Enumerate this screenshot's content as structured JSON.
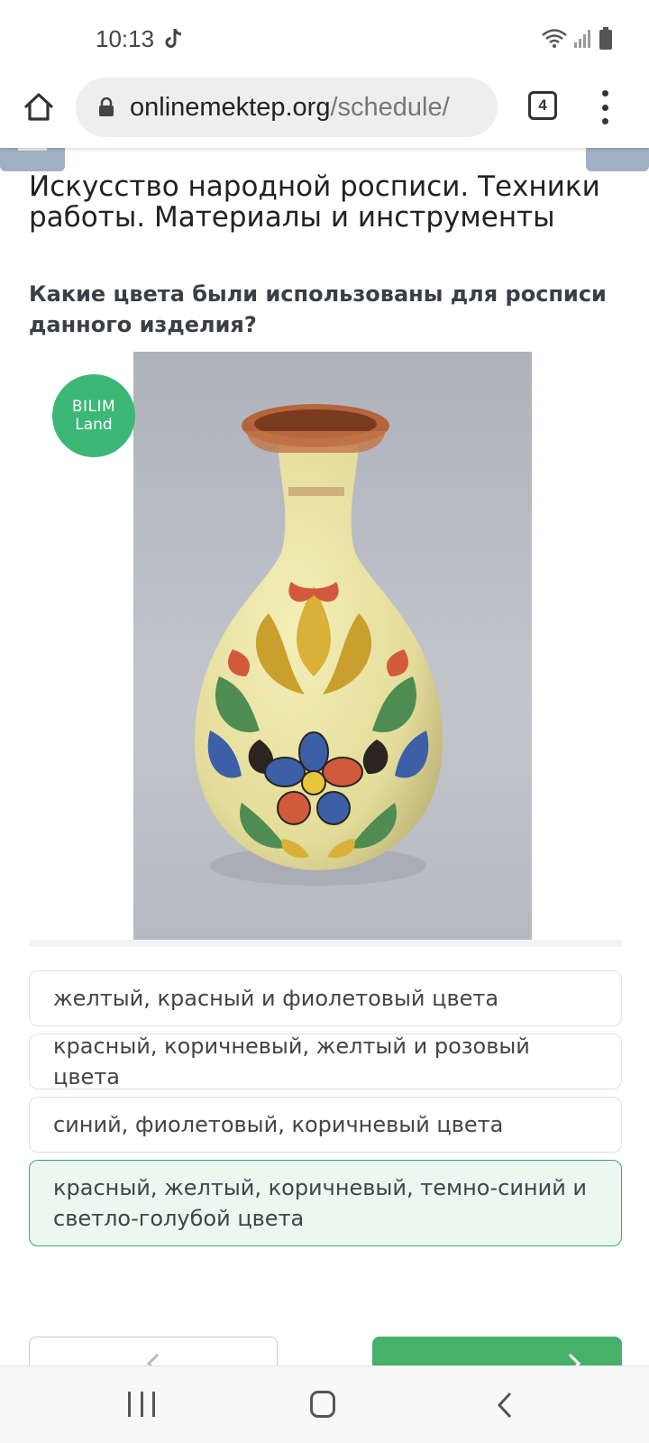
{
  "status_bar": {
    "time": "10:13"
  },
  "browser": {
    "url_host": "onlinemektep.org",
    "url_path": "/schedule/",
    "tab_count": "4"
  },
  "lesson": {
    "title": "Искусство народной росписи. Техники работы. Материалы и инструменты",
    "question": "Какие цвета были использованы для росписи данного изделия?"
  },
  "badge": {
    "line1": "BILIM",
    "line2": "Land"
  },
  "options": [
    {
      "label": "желтый, красный и фиолетовый цвета",
      "selected": false
    },
    {
      "label": "красный, коричневый, желтый и розовый цвета",
      "selected": false
    },
    {
      "label": "синий, фиолетовый, коричневый цвета",
      "selected": false
    },
    {
      "label": "красный, желтый, коричневый, темно-синий и светло-голубой цвета",
      "selected": true
    }
  ],
  "colors": {
    "accent_green": "#3cb776",
    "selected_bg": "#eaf8f1",
    "selected_border": "#3aa878",
    "next_button": "#47b06a"
  }
}
